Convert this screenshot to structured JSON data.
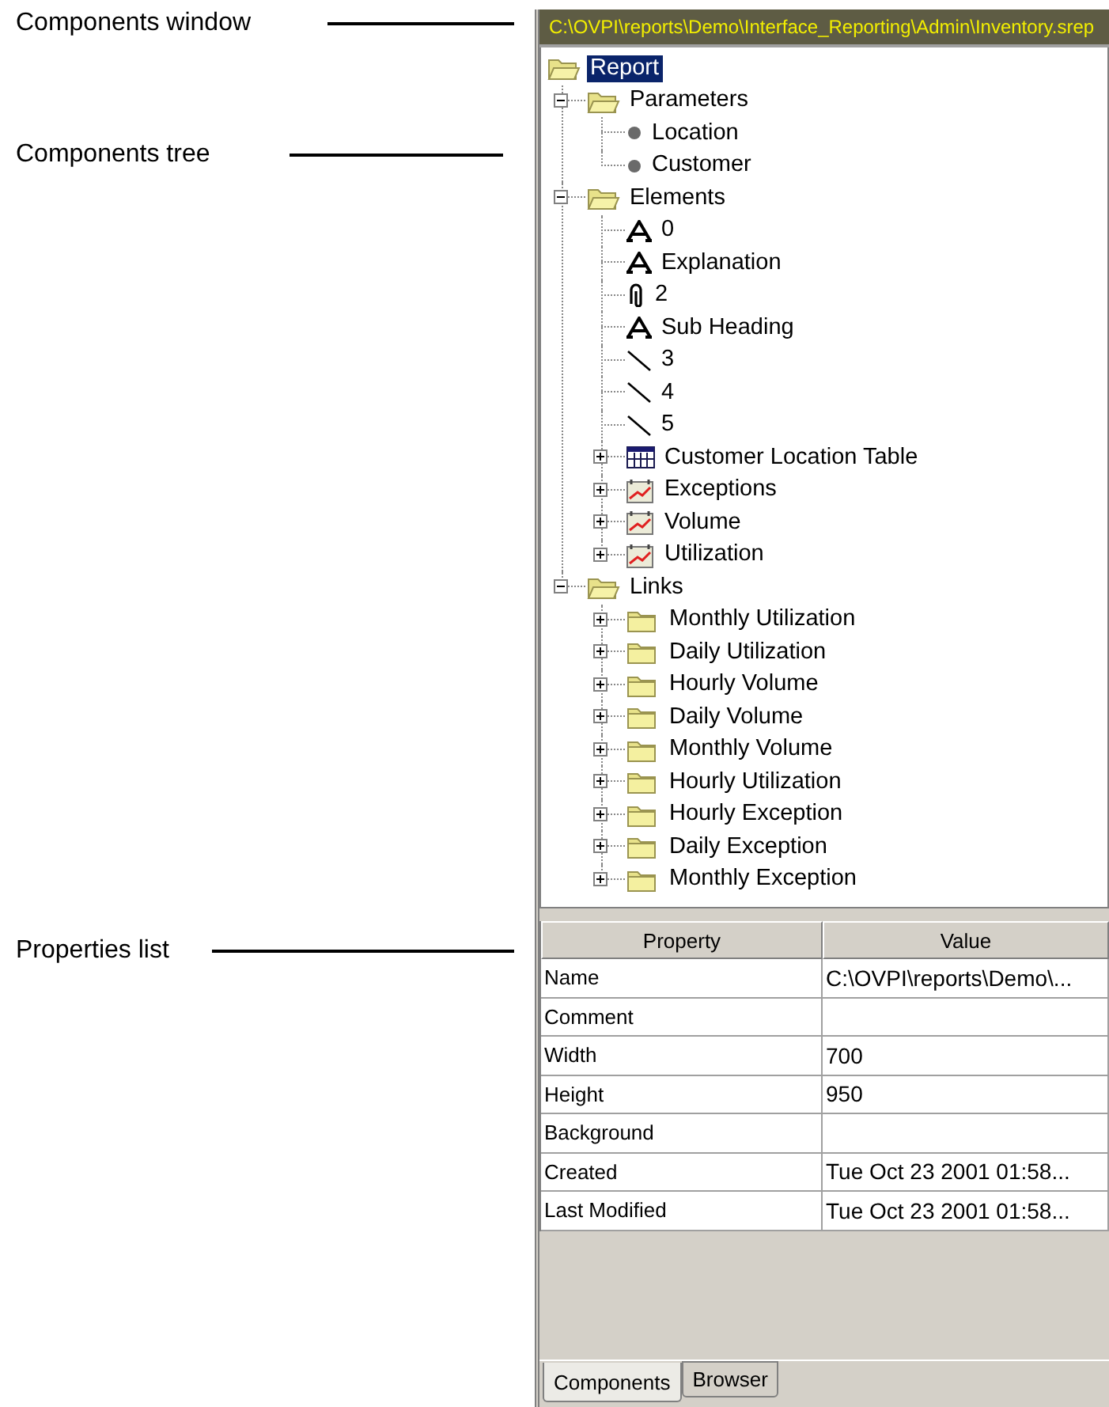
{
  "callouts": [
    {
      "label": "Components window"
    },
    {
      "label": "Components tree"
    },
    {
      "label": "Properties list"
    }
  ],
  "window": {
    "title": "C:\\OVPI\\reports\\Demo\\Interface_Reporting\\Admin\\Inventory.srep"
  },
  "tree": [
    {
      "label": "Report",
      "kind": "folder",
      "selected": true,
      "children": [
        {
          "label": "Parameters",
          "kind": "folder",
          "selected": false,
          "expanded": true,
          "children": [
            {
              "label": "Location",
              "kind": "parameter",
              "selected": false
            },
            {
              "label": "Customer",
              "kind": "parameter",
              "selected": false
            }
          ]
        },
        {
          "label": "Elements",
          "kind": "folder",
          "selected": false,
          "expanded": true,
          "children": [
            {
              "label": "0",
              "kind": "text",
              "selected": false
            },
            {
              "label": "Explanation",
              "kind": "text",
              "selected": false
            },
            {
              "label": "2",
              "kind": "image",
              "selected": false
            },
            {
              "label": "Sub Heading",
              "kind": "text",
              "selected": false
            },
            {
              "label": "3",
              "kind": "line",
              "selected": false
            },
            {
              "label": "4",
              "kind": "line",
              "selected": false
            },
            {
              "label": "5",
              "kind": "line",
              "selected": false
            },
            {
              "label": "Customer Location Table",
              "kind": "table",
              "selected": false,
              "expanded": false
            },
            {
              "label": "Exceptions",
              "kind": "chart",
              "selected": false,
              "expanded": false
            },
            {
              "label": "Volume",
              "kind": "chart",
              "selected": false,
              "expanded": false
            },
            {
              "label": "Utilization",
              "kind": "chart",
              "selected": false,
              "expanded": false
            }
          ]
        },
        {
          "label": "Links",
          "kind": "folder",
          "selected": false,
          "expanded": true,
          "children": [
            {
              "label": "Monthly Utilization",
              "kind": "folder",
              "selected": false,
              "expanded": false
            },
            {
              "label": "Daily Utilization",
              "kind": "folder",
              "selected": false,
              "expanded": false
            },
            {
              "label": "Hourly Volume",
              "kind": "folder",
              "selected": false,
              "expanded": false
            },
            {
              "label": "Daily Volume",
              "kind": "folder",
              "selected": false,
              "expanded": false
            },
            {
              "label": "Monthly Volume",
              "kind": "folder",
              "selected": false,
              "expanded": false
            },
            {
              "label": "Hourly Utilization",
              "kind": "folder",
              "selected": false,
              "expanded": false
            },
            {
              "label": "Hourly Exception",
              "kind": "folder",
              "selected": false,
              "expanded": false
            },
            {
              "label": "Daily Exception",
              "kind": "folder",
              "selected": false,
              "expanded": false
            },
            {
              "label": "Monthly Exception",
              "kind": "folder",
              "selected": false,
              "expanded": false
            }
          ]
        }
      ]
    }
  ],
  "properties": {
    "columns": [
      "Property",
      "Value"
    ],
    "rows": [
      {
        "property": "Name",
        "value": "C:\\OVPI\\reports\\Demo\\..."
      },
      {
        "property": "Comment"
      },
      {
        "property": "Width",
        "value": "700"
      },
      {
        "property": "Height",
        "value": "950"
      },
      {
        "property": "Background"
      },
      {
        "property": "Created",
        "value": "Tue Oct 23 2001 01:58..."
      },
      {
        "property": "Last Modified",
        "value": "Tue Oct 23 2001 01:58..."
      }
    ]
  },
  "tabs": [
    {
      "label": "Components",
      "selected": true
    },
    {
      "label": "Browser",
      "selected": false
    }
  ]
}
